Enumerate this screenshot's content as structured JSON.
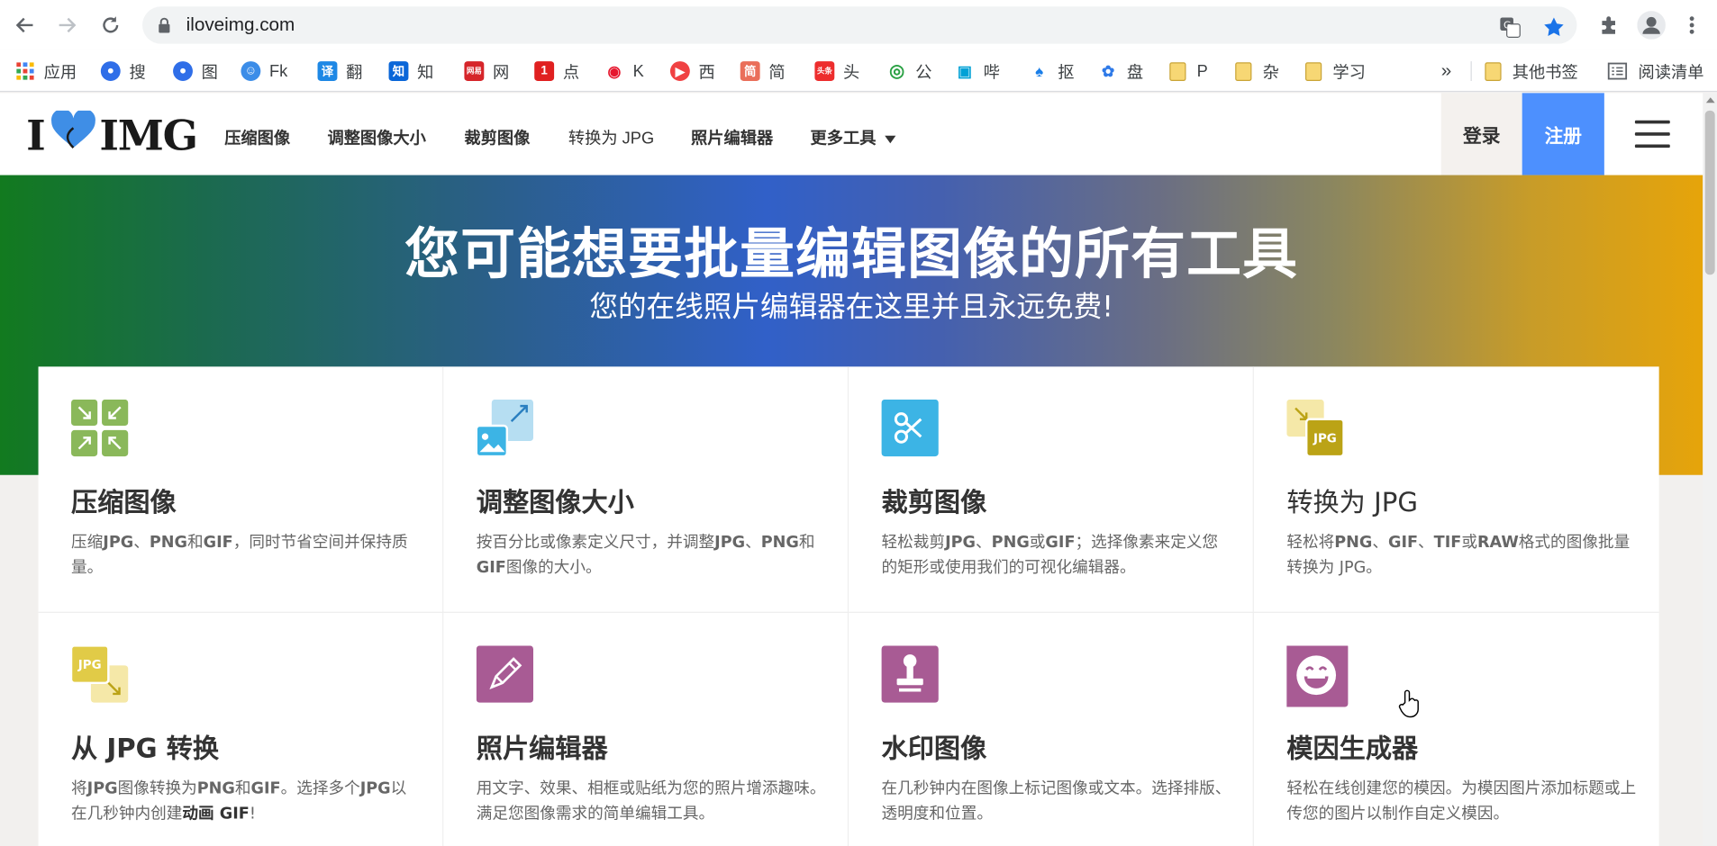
{
  "browser": {
    "url": "iloveimg.com",
    "bookmarks": [
      {
        "label": "应用",
        "icon": "apps-grid-icon"
      },
      {
        "label": "搜",
        "icon": "baidu-paw-icon"
      },
      {
        "label": "图",
        "icon": "baidu-paw-icon"
      },
      {
        "label": "Fk",
        "icon": "fk-face-icon"
      },
      {
        "label": "翻",
        "icon": "translate-icon"
      },
      {
        "label": "知",
        "icon": "zhihu-icon"
      },
      {
        "label": "网",
        "icon": "netease-icon"
      },
      {
        "label": "点",
        "icon": "one-icon"
      },
      {
        "label": "K",
        "icon": "weibo-icon"
      },
      {
        "label": "西",
        "icon": "xigua-icon"
      },
      {
        "label": "简",
        "icon": "jianshu-icon"
      },
      {
        "label": "头",
        "icon": "toutiao-icon"
      },
      {
        "label": "公",
        "icon": "wechat-icon"
      },
      {
        "label": "哔",
        "icon": "bilibili-icon"
      },
      {
        "label": "抠",
        "icon": "koutu-icon"
      },
      {
        "label": "盘",
        "icon": "baidu-pan-icon"
      },
      {
        "label": "P",
        "icon": "folder-icon"
      },
      {
        "label": "杂",
        "icon": "folder-icon"
      },
      {
        "label": "学习",
        "icon": "folder-icon"
      }
    ],
    "overflow": "»",
    "other_bookmarks": "其他书签",
    "reading_list": "阅读清单"
  },
  "site": {
    "logo_left": "I",
    "logo_right": "IMG",
    "nav": [
      "压缩图像",
      "调整图像大小",
      "裁剪图像",
      "转换为 JPG",
      "照片编辑器",
      "更多工具"
    ],
    "login": "登录",
    "signup": "注册"
  },
  "hero": {
    "title": "您可能想要批量编辑图像的所有工具",
    "subtitle": "您的在线照片编辑器在这里并且永远免费!"
  },
  "tools": [
    {
      "title": "压缩图像",
      "desc_html": "压缩<b>JPG</b>、<b>PNG</b>和<b>GIF</b>，同时节省空间并保持质量。",
      "icon": "compress-icon"
    },
    {
      "title": "调整图像大小",
      "desc_html": "按百分比或像素定义尺寸，并调整<b>JPG</b>、<b>PNG</b>和<b>GIF</b>图像的大小。",
      "icon": "resize-icon"
    },
    {
      "title": "裁剪图像",
      "desc_html": "轻松裁剪<b>JPG</b>、<b>PNG</b>或<b>GIF</b>；选择像素来定义您的矩形或使用我们的可视化编辑器。",
      "icon": "scissors-icon"
    },
    {
      "title": "转换为 JPG",
      "desc_html": "轻松将<b>PNG</b>、<b>GIF</b>、<b>TIF</b>或<b>RAW</b>格式的图像批量转换为 JPG。",
      "icon": "convert-to-jpg-icon"
    },
    {
      "title": "从 JPG 转换",
      "desc_html": "将<b>JPG</b>图像转换为<b>PNG</b>和<b>GIF</b>。选择多个<b>JPG</b>以在几秒钟内创建<b style=\"color:#333\">动画 GIF</b>!",
      "icon": "convert-from-jpg-icon"
    },
    {
      "title": "照片编辑器",
      "desc_html": "用文字、效果、相框或贴纸为您的照片增添趣味。满足您图像需求的简单编辑工具。",
      "icon": "pencil-icon"
    },
    {
      "title": "水印图像",
      "desc_html": "在几秒钟内在图像上标记图像或文本。选择排版、透明度和位置。",
      "icon": "stamp-icon"
    },
    {
      "title": "模因生成器",
      "desc_html": "轻松在线创建您的模因。为模因图片添加标题或上传您的图片以制作自定义模因。",
      "icon": "laughing-face-icon"
    }
  ],
  "icon_text": {
    "jpg": "JPG"
  },
  "colors": {
    "green": "#8ab85a",
    "blue": "#3cb4e5",
    "lightblue": "#b6def2",
    "olive": "#bba316",
    "yellow": "#e1cb47",
    "purple": "#a85b94",
    "signup": "#4d90fe"
  }
}
